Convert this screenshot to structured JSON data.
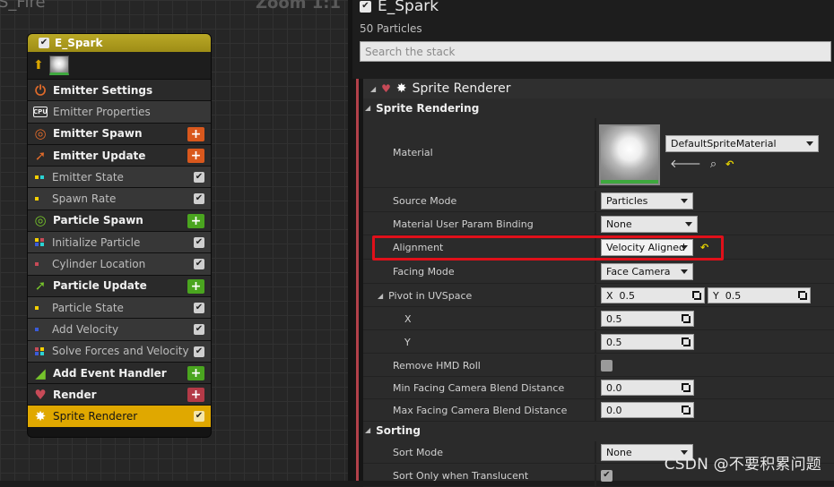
{
  "graph": {
    "title": "S_Fire",
    "zoom": "Zoom 1:1"
  },
  "node": {
    "title": "E_Spark",
    "items": [
      {
        "label": "Emitter Settings",
        "kind": "section",
        "icon": "emitter-settings-icon",
        "color": "#e06b2a"
      },
      {
        "label": "Emitter Properties",
        "kind": "module",
        "icon": "cpu-icon"
      },
      {
        "label": "Emitter Spawn",
        "kind": "section",
        "icon": "ring-icon",
        "color": "#e06b2a",
        "button": "+",
        "btn_color": "orange"
      },
      {
        "label": "Emitter Update",
        "kind": "section",
        "icon": "arrow-up-right-icon",
        "color": "#e06b2a",
        "button": "+",
        "btn_color": "orange"
      },
      {
        "label": "Emitter State",
        "kind": "module",
        "check": true
      },
      {
        "label": "Spawn Rate",
        "kind": "module",
        "check": true
      },
      {
        "label": "Particle Spawn",
        "kind": "section",
        "icon": "ring-icon",
        "color": "#76c32b",
        "button": "+",
        "btn_color": "green"
      },
      {
        "label": "Initialize Particle",
        "kind": "module",
        "check": true
      },
      {
        "label": "Cylinder Location",
        "kind": "module",
        "check": true
      },
      {
        "label": "Particle Update",
        "kind": "section",
        "icon": "arrow-up-right-icon",
        "color": "#76c32b",
        "button": "+",
        "btn_color": "green"
      },
      {
        "label": "Particle State",
        "kind": "module",
        "check": true
      },
      {
        "label": "Add Velocity",
        "kind": "module",
        "check": true
      },
      {
        "label": "Solve Forces and Velocity",
        "kind": "module",
        "check": true
      },
      {
        "label": "Add Event Handler",
        "kind": "section",
        "icon": "signal-icon",
        "color": "#76c32b",
        "button": "+",
        "btn_color": "green"
      },
      {
        "label": "Render",
        "kind": "section",
        "icon": "render-icon",
        "color": "#c74a57",
        "button": "+",
        "btn_color": "red"
      },
      {
        "label": "Sprite Renderer",
        "kind": "selected",
        "icon": "sparkle-icon",
        "check": true
      }
    ]
  },
  "panel": {
    "title": "E_Spark",
    "particle_count": "50 Particles",
    "search_placeholder": "Search the stack",
    "renderer_header": "Sprite Renderer",
    "section_rendering": "Sprite Rendering",
    "section_sorting": "Sorting",
    "props": {
      "material": {
        "label": "Material",
        "value": "DefaultSpriteMaterial"
      },
      "source_mode": {
        "label": "Source Mode",
        "value": "Particles"
      },
      "mat_user_param": {
        "label": "Material User Param Binding",
        "value": "None"
      },
      "alignment": {
        "label": "Alignment",
        "value": "Velocity Aligned"
      },
      "facing_mode": {
        "label": "Facing Mode",
        "value": "Face Camera"
      },
      "pivot": {
        "label": "Pivot in UVSpace",
        "x_label": "X",
        "x": "0.5",
        "y_label": "Y",
        "y": "0.5"
      },
      "pivot_x": {
        "label": "X",
        "value": "0.5"
      },
      "pivot_y": {
        "label": "Y",
        "value": "0.5"
      },
      "remove_hmd": {
        "label": "Remove HMD Roll"
      },
      "min_facing": {
        "label": "Min Facing Camera Blend Distance",
        "value": "0.0"
      },
      "max_facing": {
        "label": "Max Facing Camera Blend Distance",
        "value": "0.0"
      },
      "sort_mode": {
        "label": "Sort Mode",
        "value": "None"
      },
      "sort_translucent": {
        "label": "Sort Only when Translucent"
      }
    }
  },
  "watermark": "CSDN @不要积累问题"
}
